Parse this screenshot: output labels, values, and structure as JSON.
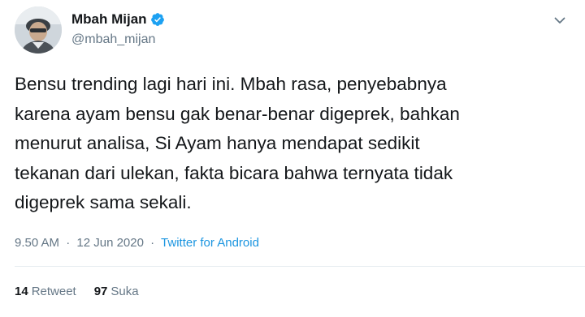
{
  "tweet": {
    "author": {
      "name": "Mbah Mijan",
      "handle": "@mbah_mijan",
      "verified": true
    },
    "text_lines": [
      "Bensu trending lagi hari ini. Mbah rasa, penyebabnya",
      "karena ayam bensu gak benar-benar digeprek, bahkan",
      "menurut analisa, Si Ayam hanya mendapat sedikit",
      "tekanan dari ulekan, fakta bicara bahwa ternyata tidak",
      "digeprek sama sekali."
    ],
    "time": "9.50 AM",
    "date": "12 Jun 2020",
    "separator": "·",
    "source": "Twitter for Android",
    "stats": {
      "retweets_count": "14",
      "retweets_label": "Retweet",
      "likes_count": "97",
      "likes_label": "Suka"
    }
  },
  "colors": {
    "text": "#14171a",
    "secondary": "#657786",
    "link": "#1b95e0",
    "verified": "#1da1f2",
    "divider": "#e6ecf0"
  },
  "icons": {
    "verified": "verified-badge-icon",
    "menu": "chevron-down-icon"
  }
}
